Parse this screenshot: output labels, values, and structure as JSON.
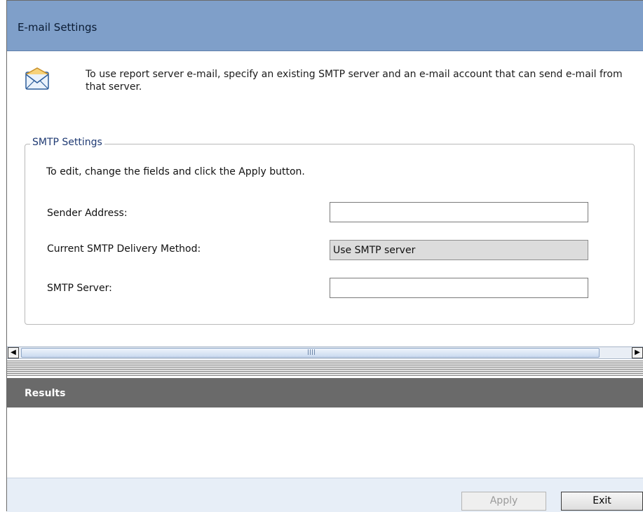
{
  "header": {
    "title": "E-mail Settings"
  },
  "intro": {
    "icon": "envelope-icon",
    "text": "To use report server e-mail, specify an existing SMTP server and an e-mail account that can send e-mail from that server."
  },
  "smtp": {
    "legend": "SMTP Settings",
    "instructions": "To edit, change the fields and click the Apply button.",
    "sender_label": "Sender Address:",
    "sender_value": "",
    "method_label": "Current SMTP Delivery Method:",
    "method_value": "Use SMTP server",
    "server_label": "SMTP Server:",
    "server_value": ""
  },
  "scrollbar": {
    "left_icon": "arrow-left-icon",
    "right_icon": "arrow-right-icon",
    "grip_icon": "grip-icon"
  },
  "results": {
    "label": "Results"
  },
  "footer": {
    "apply_label": "Apply",
    "exit_label": "Exit"
  }
}
